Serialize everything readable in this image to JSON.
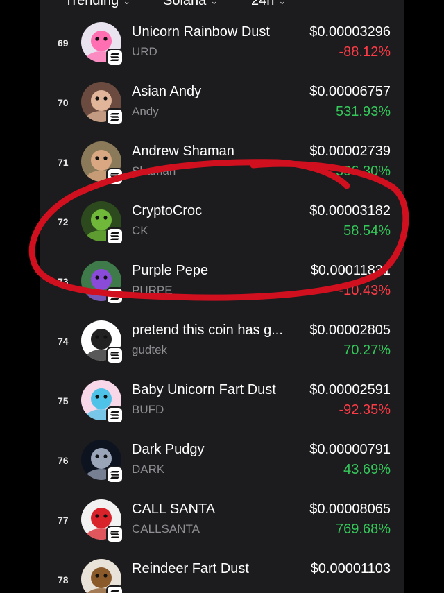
{
  "filters": [
    {
      "label": "Trending"
    },
    {
      "label": "Solana"
    },
    {
      "label": "24h"
    }
  ],
  "colors": {
    "positive": "#34c759",
    "negative": "#ff3b46",
    "annotation": "#d0101e"
  },
  "tokens": [
    {
      "rank": "69",
      "name": "Unicorn Rainbow Dust",
      "symbol": "URD",
      "price": "$0.00003296",
      "change": "-88.12%",
      "trend": "neg"
    },
    {
      "rank": "70",
      "name": "Asian Andy",
      "symbol": "Andy",
      "price": "$0.00006757",
      "change": "531.93%",
      "trend": "pos"
    },
    {
      "rank": "71",
      "name": "Andrew Shaman",
      "symbol": "Shaman",
      "price": "$0.00002739",
      "change": "396.30%",
      "trend": "pos"
    },
    {
      "rank": "72",
      "name": "CryptoCroc",
      "symbol": "CK",
      "price": "$0.00003182",
      "change": "58.54%",
      "trend": "pos"
    },
    {
      "rank": "73",
      "name": "Purple Pepe",
      "symbol": "PURPE",
      "price": "$0.00011831",
      "change": "-10.43%",
      "trend": "neg"
    },
    {
      "rank": "74",
      "name": "pretend this coin has g...",
      "symbol": "gudtek",
      "price": "$0.00002805",
      "change": "70.27%",
      "trend": "pos"
    },
    {
      "rank": "75",
      "name": "Baby Unicorn Fart Dust",
      "symbol": "BUFD",
      "price": "$0.00002591",
      "change": "-92.35%",
      "trend": "neg"
    },
    {
      "rank": "76",
      "name": "Dark Pudgy",
      "symbol": "DARK",
      "price": "$0.00000791",
      "change": "43.69%",
      "trend": "pos"
    },
    {
      "rank": "77",
      "name": "CALL SANTA",
      "symbol": "CALLSANTA",
      "price": "$0.00008065",
      "change": "769.68%",
      "trend": "pos"
    },
    {
      "rank": "78",
      "name": "Reindeer Fart Dust",
      "symbol": "",
      "price": "$0.00001103",
      "change": "",
      "trend": "pos"
    }
  ],
  "avatars": [
    {
      "icon": "unicorn-avatar-icon",
      "bg": "#e9e3f0",
      "fg": "#ff6fb1"
    },
    {
      "icon": "man-glasses-avatar-icon",
      "bg": "#6b4b3f",
      "fg": "#e0b59a"
    },
    {
      "icon": "shaman-avatar-icon",
      "bg": "#8a7a5a",
      "fg": "#d9a882"
    },
    {
      "icon": "crocodile-avatar-icon",
      "bg": "#2d4a1e",
      "fg": "#6fb83a"
    },
    {
      "icon": "purple-frog-avatar-icon",
      "bg": "#3f7a4a",
      "fg": "#8a4bd8"
    },
    {
      "icon": "gudtek-sketch-avatar-icon",
      "bg": "#ffffff",
      "fg": "#222222"
    },
    {
      "icon": "baby-unicorn-avatar-icon",
      "bg": "#f7d7e8",
      "fg": "#4fc2e8"
    },
    {
      "icon": "dark-penguin-avatar-icon",
      "bg": "#0e1320",
      "fg": "#9aa6b8"
    },
    {
      "icon": "santa-avatar-icon",
      "bg": "#f2f2f2",
      "fg": "#d8232a"
    },
    {
      "icon": "reindeer-avatar-icon",
      "bg": "#e9e2d8",
      "fg": "#8b5a2b"
    }
  ]
}
